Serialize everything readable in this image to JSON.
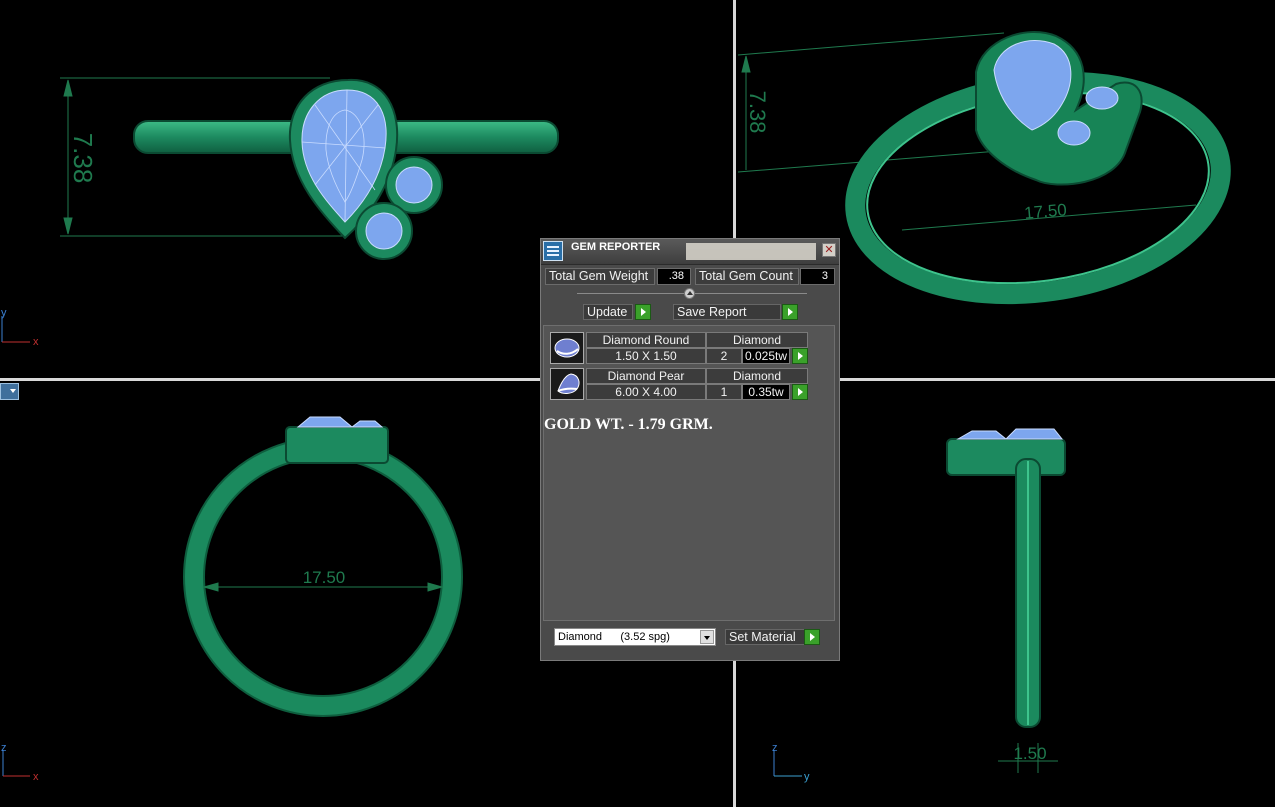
{
  "viewports": {
    "top_left": {
      "dimension_label": "7.38",
      "axis_a": "y",
      "axis_b": "x"
    },
    "top_right": {
      "dimension_label_a": "7.38",
      "dimension_label_b": "17.50"
    },
    "bottom_left": {
      "dimension_label": "17.50",
      "axis_a": "z",
      "axis_b": "x"
    },
    "bottom_right": {
      "dimension_label": "1.50",
      "axis_a": "z",
      "axis_b": "y"
    }
  },
  "gem_reporter": {
    "title": "GEM REPORTER",
    "close_glyph": "✕",
    "total_weight_label": "Total Gem Weight",
    "total_weight_value": ".38",
    "total_count_label": "Total Gem Count",
    "total_count_value": "3",
    "update_label": "Update",
    "save_report_label": "Save Report",
    "gems": [
      {
        "name": "Diamond Round",
        "material": "Diamond",
        "size": "1.50 X 1.50",
        "count": "2",
        "weight": "0.025tw"
      },
      {
        "name": "Diamond Pear",
        "material": "Diamond",
        "size": "6.00 X 4.00",
        "count": "1",
        "weight": "0.35tw"
      }
    ],
    "annotation": "GOLD WT. - 1.79 GRM.",
    "material_select_value": "Diamond      (3.52 spg)",
    "set_material_label": "Set Material"
  },
  "colors": {
    "metal": "#1f8a62",
    "gem": "#7da6ee",
    "dimension": "#1f7a4e",
    "go_button": "#3aa12a"
  }
}
